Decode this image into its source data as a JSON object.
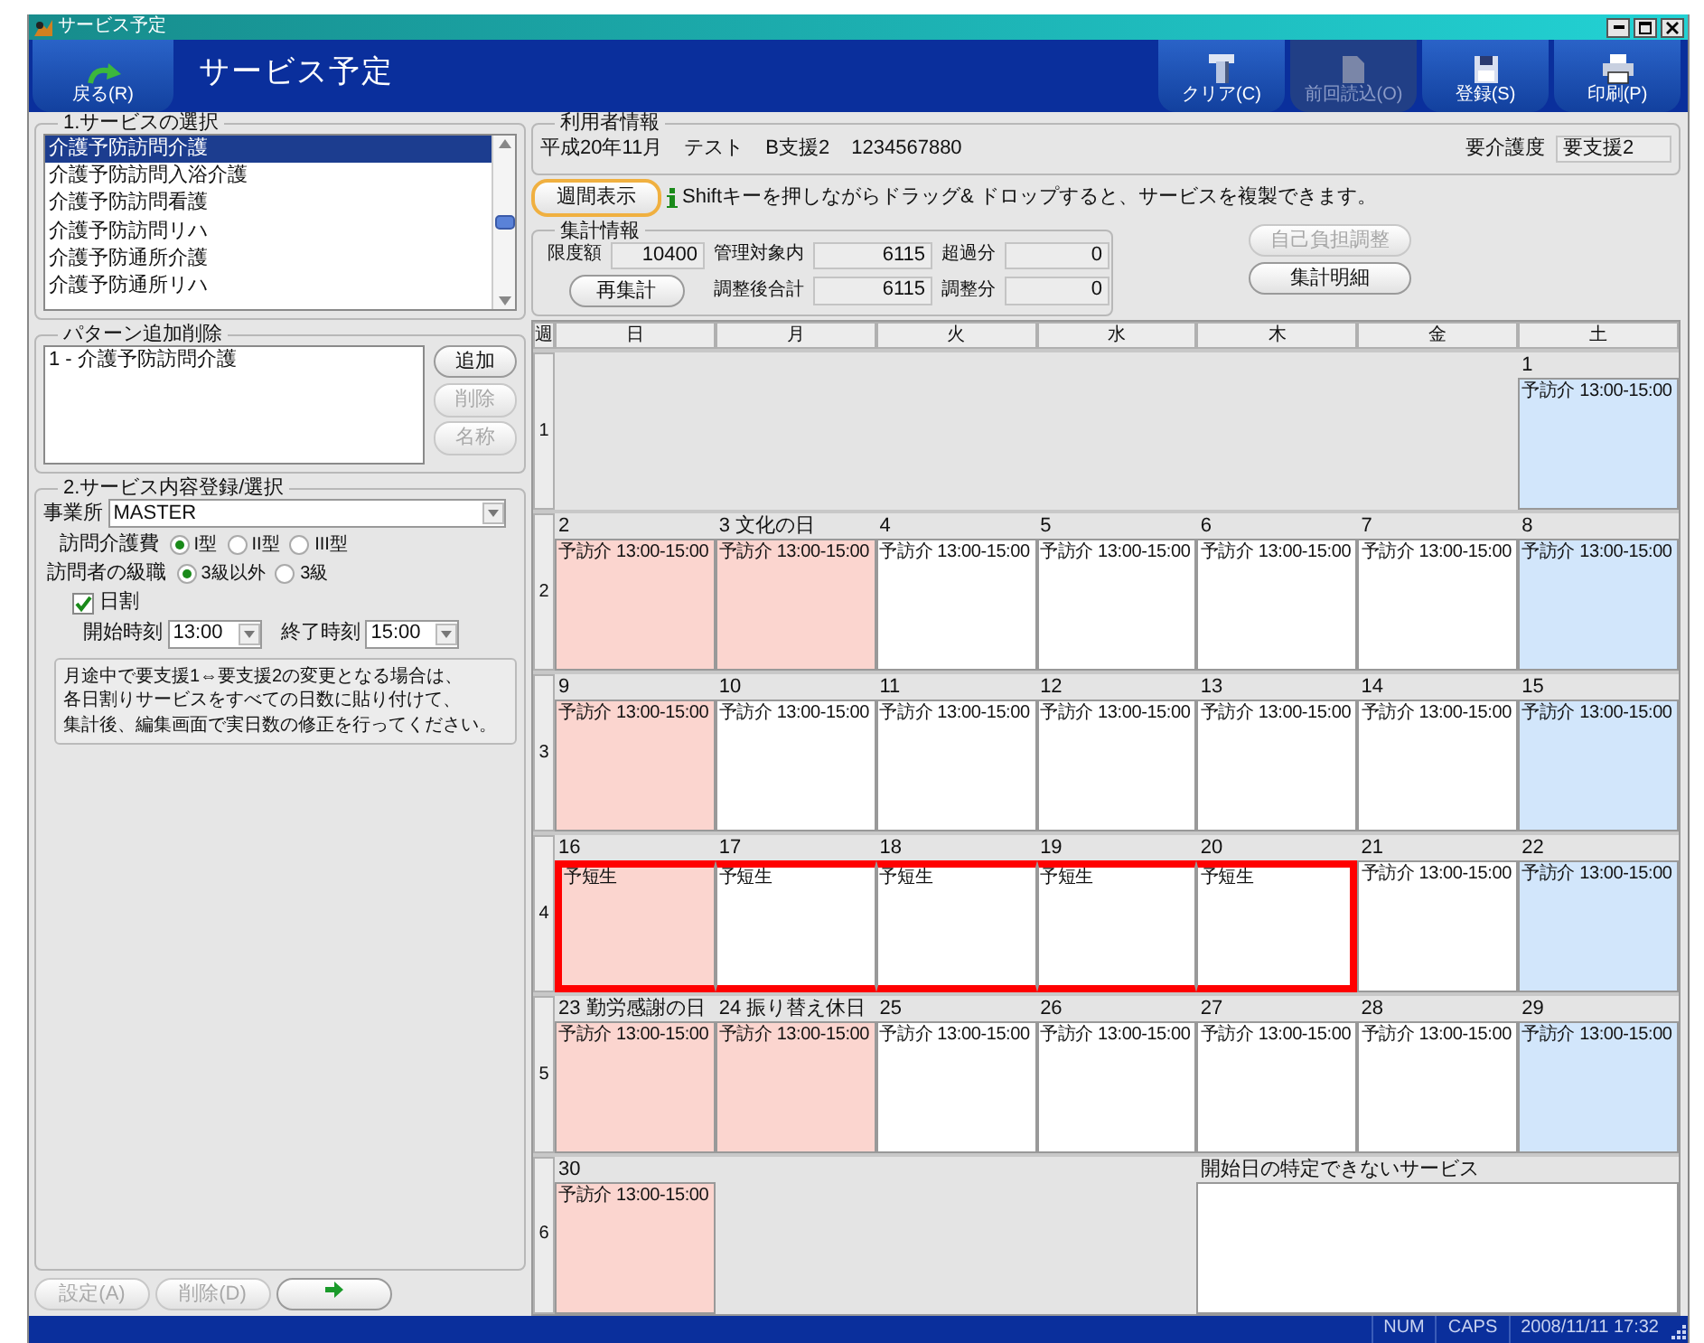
{
  "window": {
    "title": "サービス予定"
  },
  "toolbar": {
    "back": {
      "label": "戻る(R)"
    },
    "title": "サービス予定",
    "buttons": [
      {
        "label": "クリア(C)",
        "disabled": false
      },
      {
        "label": "前回読込(O)",
        "disabled": true
      },
      {
        "label": "登録(S)",
        "disabled": false
      },
      {
        "label": "印刷(P)",
        "disabled": false
      }
    ]
  },
  "service_selection": {
    "title": "1.サービスの選択",
    "items": [
      {
        "label": "介護予防訪問介護",
        "selected": true
      },
      {
        "label": "介護予防訪問入浴介護",
        "selected": false
      },
      {
        "label": "介護予防訪問看護",
        "selected": false
      },
      {
        "label": "介護予防訪問リハ",
        "selected": false
      },
      {
        "label": "介護予防通所介護",
        "selected": false
      },
      {
        "label": "介護予防通所リハ",
        "selected": false
      }
    ]
  },
  "patterns": {
    "title": "パターン追加削除",
    "items": [
      "1 - 介護予防訪問介護"
    ],
    "buttons": [
      {
        "label": "追加",
        "disabled": false
      },
      {
        "label": "削除",
        "disabled": true
      },
      {
        "label": "名称",
        "disabled": true
      }
    ]
  },
  "service_detail": {
    "title": "2.サービス内容登録/選択",
    "office": {
      "label": "事業所",
      "value": "MASTER"
    },
    "radio_groups": [
      {
        "label": "訪問介護費",
        "options": [
          {
            "label": "I型",
            "selected": true
          },
          {
            "label": "II型",
            "selected": false
          },
          {
            "label": "III型",
            "selected": false
          }
        ]
      },
      {
        "label": "訪問者の級職",
        "options": [
          {
            "label": "3級以外",
            "selected": true
          },
          {
            "label": "3級",
            "selected": false
          }
        ]
      }
    ],
    "daily": {
      "label": "日割",
      "checked": true
    },
    "start_time": {
      "label": "開始時刻",
      "value": "13:00"
    },
    "end_time": {
      "label": "終了時刻",
      "value": "15:00"
    },
    "note": [
      "月途中で要支援1⇔要支援2の変更となる場合は、",
      "各日割りサービスをすべての日数に貼り付けて、",
      "集計後、編集画面で実日数の修正を行ってください。"
    ]
  },
  "bottom_buttons": [
    {
      "kind": "text",
      "label": "設定(A)",
      "disabled": true
    },
    {
      "kind": "text",
      "label": "削除(D)",
      "disabled": true
    },
    {
      "kind": "arrow",
      "disabled": false
    }
  ],
  "user_info": {
    "title": "利用者情報",
    "fields": [
      "平成20年11月",
      "テスト",
      "B支援2",
      "1234567880"
    ],
    "care_level": {
      "label": "要介護度",
      "value": "要支援2"
    }
  },
  "weekly_button": {
    "label": "週間表示",
    "focused": true
  },
  "hint": "Shiftキーを押しながらドラッグ& ドロップすると、サービスを複製できます。",
  "totals": {
    "title": "集計情報",
    "rows": [
      [
        {
          "kind": "field",
          "label": "限度額",
          "value": "10400"
        },
        {
          "kind": "field",
          "label": "管理対象内",
          "value": "6115"
        },
        {
          "kind": "field",
          "label": "超過分",
          "value": "0"
        }
      ],
      [
        {
          "kind": "button",
          "label": "再集計"
        },
        {
          "kind": "field",
          "label": "調整後合計",
          "value": "6115"
        },
        {
          "kind": "field",
          "label": "調整分",
          "value": "0"
        }
      ]
    ],
    "buttons": [
      {
        "label": "自己負担調整",
        "disabled": true
      },
      {
        "label": "集計明細",
        "disabled": false
      }
    ]
  },
  "calendar": {
    "week_header": "週",
    "weekdays": [
      "日",
      "月",
      "火",
      "水",
      "木",
      "金",
      "土"
    ],
    "weeks": [
      {
        "label": "1",
        "days": [
          {
            "kind": "blank"
          },
          {
            "kind": "blank"
          },
          {
            "kind": "blank"
          },
          {
            "kind": "blank"
          },
          {
            "kind": "blank"
          },
          {
            "kind": "blank"
          },
          {
            "kind": "saturday",
            "date": "1",
            "entries": [
              "予訪介 13:00-15:00"
            ],
            "highlighted": false
          }
        ]
      },
      {
        "label": "2",
        "days": [
          {
            "kind": "holiday",
            "date": "2",
            "entries": [
              "予訪介 13:00-15:00"
            ],
            "highlighted": false
          },
          {
            "kind": "holiday",
            "date": "3",
            "holiday": "文化の日",
            "entries": [
              "予訪介 13:00-15:00"
            ],
            "highlighted": false
          },
          {
            "kind": "weekday",
            "date": "4",
            "entries": [
              "予訪介 13:00-15:00"
            ],
            "highlighted": false
          },
          {
            "kind": "weekday",
            "date": "5",
            "entries": [
              "予訪介 13:00-15:00"
            ],
            "highlighted": false
          },
          {
            "kind": "weekday",
            "date": "6",
            "entries": [
              "予訪介 13:00-15:00"
            ],
            "highlighted": false
          },
          {
            "kind": "weekday",
            "date": "7",
            "entries": [
              "予訪介 13:00-15:00"
            ],
            "highlighted": false
          },
          {
            "kind": "saturday",
            "date": "8",
            "entries": [
              "予訪介 13:00-15:00"
            ],
            "highlighted": false
          }
        ]
      },
      {
        "label": "3",
        "days": [
          {
            "kind": "holiday",
            "date": "9",
            "entries": [
              "予訪介 13:00-15:00"
            ],
            "highlighted": false
          },
          {
            "kind": "weekday",
            "date": "10",
            "entries": [
              "予訪介 13:00-15:00"
            ],
            "highlighted": false
          },
          {
            "kind": "weekday",
            "date": "11",
            "entries": [
              "予訪介 13:00-15:00"
            ],
            "highlighted": false
          },
          {
            "kind": "weekday",
            "date": "12",
            "entries": [
              "予訪介 13:00-15:00"
            ],
            "highlighted": false
          },
          {
            "kind": "weekday",
            "date": "13",
            "entries": [
              "予訪介 13:00-15:00"
            ],
            "highlighted": false
          },
          {
            "kind": "weekday",
            "date": "14",
            "entries": [
              "予訪介 13:00-15:00"
            ],
            "highlighted": false
          },
          {
            "kind": "saturday",
            "date": "15",
            "entries": [
              "予訪介 13:00-15:00"
            ],
            "highlighted": false
          }
        ]
      },
      {
        "label": "4",
        "days": [
          {
            "kind": "holiday",
            "date": "16",
            "entries": [
              "予短生"
            ],
            "highlighted": true
          },
          {
            "kind": "weekday",
            "date": "17",
            "entries": [
              "予短生"
            ],
            "highlighted": true
          },
          {
            "kind": "weekday",
            "date": "18",
            "entries": [
              "予短生"
            ],
            "highlighted": true
          },
          {
            "kind": "weekday",
            "date": "19",
            "entries": [
              "予短生"
            ],
            "highlighted": true
          },
          {
            "kind": "weekday",
            "date": "20",
            "entries": [
              "予短生"
            ],
            "highlighted": true
          },
          {
            "kind": "weekday",
            "date": "21",
            "entries": [
              "予訪介 13:00-15:00"
            ],
            "highlighted": false
          },
          {
            "kind": "saturday",
            "date": "22",
            "entries": [
              "予訪介 13:00-15:00"
            ],
            "highlighted": false
          }
        ]
      },
      {
        "label": "5",
        "days": [
          {
            "kind": "holiday",
            "date": "23",
            "holiday": "勤労感謝の日",
            "entries": [
              "予訪介 13:00-15:00"
            ],
            "highlighted": false
          },
          {
            "kind": "holiday",
            "date": "24",
            "holiday": "振り替え休日",
            "entries": [
              "予訪介 13:00-15:00"
            ],
            "highlighted": false
          },
          {
            "kind": "weekday",
            "date": "25",
            "entries": [
              "予訪介 13:00-15:00"
            ],
            "highlighted": false
          },
          {
            "kind": "weekday",
            "date": "26",
            "entries": [
              "予訪介 13:00-15:00"
            ],
            "highlighted": false
          },
          {
            "kind": "weekday",
            "date": "27",
            "entries": [
              "予訪介 13:00-15:00"
            ],
            "highlighted": false
          },
          {
            "kind": "weekday",
            "date": "28",
            "entries": [
              "予訪介 13:00-15:00"
            ],
            "highlighted": false
          },
          {
            "kind": "saturday",
            "date": "29",
            "entries": [
              "予訪介 13:00-15:00"
            ],
            "highlighted": false
          }
        ]
      },
      {
        "label": "6",
        "days": [
          {
            "kind": "holiday",
            "date": "30",
            "entries": [
              "予訪介 13:00-15:00"
            ],
            "highlighted": false
          },
          {
            "kind": "blank"
          },
          {
            "kind": "blank"
          }
        ]
      }
    ],
    "unscheduled": {
      "title": "開始日の特定できないサービス"
    }
  },
  "status_bar": [
    "NUM",
    "CAPS",
    "2008/11/11 17:32"
  ]
}
